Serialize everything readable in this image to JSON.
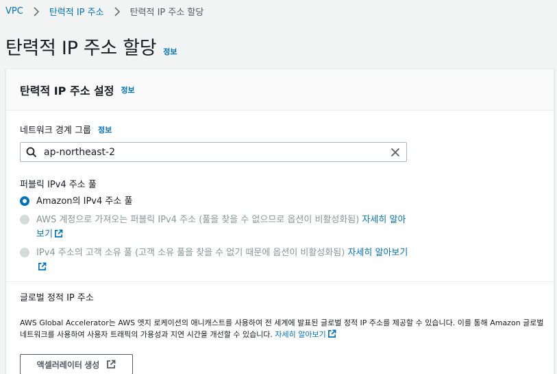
{
  "breadcrumb": {
    "items": [
      "VPC",
      "탄력적 IP 주소",
      "탄력적 IP 주소 할당"
    ]
  },
  "header": {
    "title": "탄력적 IP 주소 할당",
    "info": "정보"
  },
  "settings": {
    "title": "탄력적 IP 주소 설정",
    "info": "정보",
    "network_border_group": {
      "label": "네트워크 경계 그룹",
      "info": "정보",
      "value": "ap-northeast-2"
    },
    "public_pool": {
      "label": "퍼블릭 IPv4 주소 풀",
      "options": [
        {
          "text": "Amazon의 IPv4 주소 풀",
          "link": "",
          "selected": true,
          "disabled": false
        },
        {
          "text": "AWS 계정으로 가져오는 퍼블릭 IPv4 주소 (풀을 찾을 수 없으므로 옵션이 비활성화됨) ",
          "link": "자세히 알아보기",
          "selected": false,
          "disabled": true
        },
        {
          "text": "IPv4 주소의 고객 소유 풀 (고객 소유 풀을 찾을 수 없기 때문에 옵션이 비활성화됨) ",
          "link": "자세히 알아보기",
          "selected": false,
          "disabled": true
        }
      ]
    },
    "global_static": {
      "title": "글로벌 정적 IP 주소",
      "description": "AWS Global Accelerator는 AWS 엣지 로케이션의 애니캐스트를 사용하여 전 세계에 발표된 글로벌 정적 IP 주소를 제공할 수 있습니다. 이를 통해 Amazon 글로벌 네트워크를 사용하여 사용자 트래픽의 가용성과 지연 시간을 개선할 수 있습니다. ",
      "learn_more": "자세히 알아보기",
      "button": "액셀러레이터 생성"
    }
  },
  "colors": {
    "link": "#0073bb",
    "text": "#16191f",
    "muted": "#879596",
    "background": "#f2f3f3"
  }
}
